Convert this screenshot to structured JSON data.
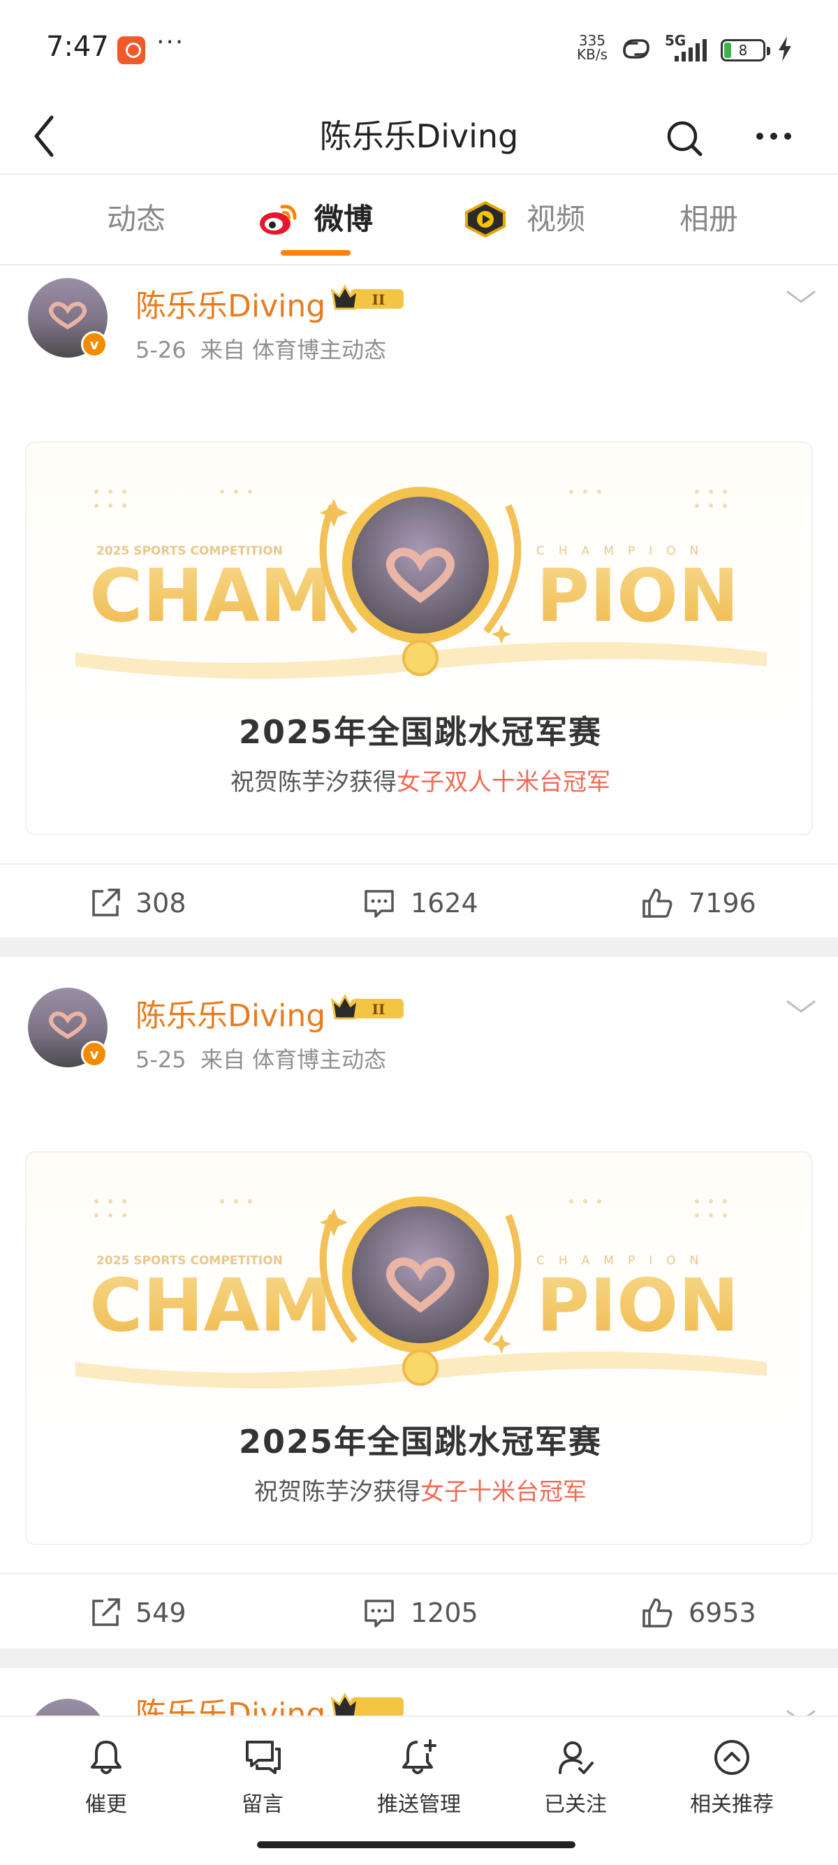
{
  "status_bar": {
    "time": "7:47",
    "rate_top": "335",
    "rate_bottom": "KB/s",
    "network": "5G",
    "battery": "8"
  },
  "nav": {
    "title": "陈乐乐Diving"
  },
  "tabs": [
    {
      "label": "动态",
      "active": false
    },
    {
      "label": "微博",
      "active": true
    },
    {
      "label": "视频",
      "active": false
    },
    {
      "label": "相册",
      "active": false
    }
  ],
  "posts": [
    {
      "author": "陈乐乐Diving",
      "crown_level": "II",
      "date": "5-26",
      "source": "来自 体育博主动态",
      "card": {
        "competition": "2025 SPORTS COMPETITION",
        "champion_word": "CHAMPION",
        "cham": "CHAM",
        "pion": "PION",
        "headline": "2025年全国跳水冠军赛",
        "sub_prefix": "祝贺陈芋汐获得",
        "sub_highlight": "女子双人十米台冠军"
      },
      "reposts": "308",
      "comments": "1624",
      "likes": "7196"
    },
    {
      "author": "陈乐乐Diving",
      "crown_level": "II",
      "date": "5-25",
      "source": "来自 体育博主动态",
      "card": {
        "competition": "2025 SPORTS COMPETITION",
        "champion_word": "CHAMPION",
        "cham": "CHAM",
        "pion": "PION",
        "headline": "2025年全国跳水冠军赛",
        "sub_prefix": "祝贺陈芋汐获得",
        "sub_highlight": "女子十米台冠军"
      },
      "reposts": "549",
      "comments": "1205",
      "likes": "6953"
    },
    {
      "author": "陈乐乐Diving",
      "crown_level": "II"
    }
  ],
  "bottom_bar": [
    {
      "label": "催更",
      "icon": "bell-icon"
    },
    {
      "label": "留言",
      "icon": "chat-icon"
    },
    {
      "label": "推送管理",
      "icon": "bell-plus-icon"
    },
    {
      "label": "已关注",
      "icon": "user-check-icon"
    },
    {
      "label": "相关推荐",
      "icon": "up-circle-icon"
    }
  ],
  "colors": {
    "accent": "#ff8200",
    "username": "#e87b1e",
    "highlight": "#f06a55",
    "gold": "#f2c056"
  }
}
